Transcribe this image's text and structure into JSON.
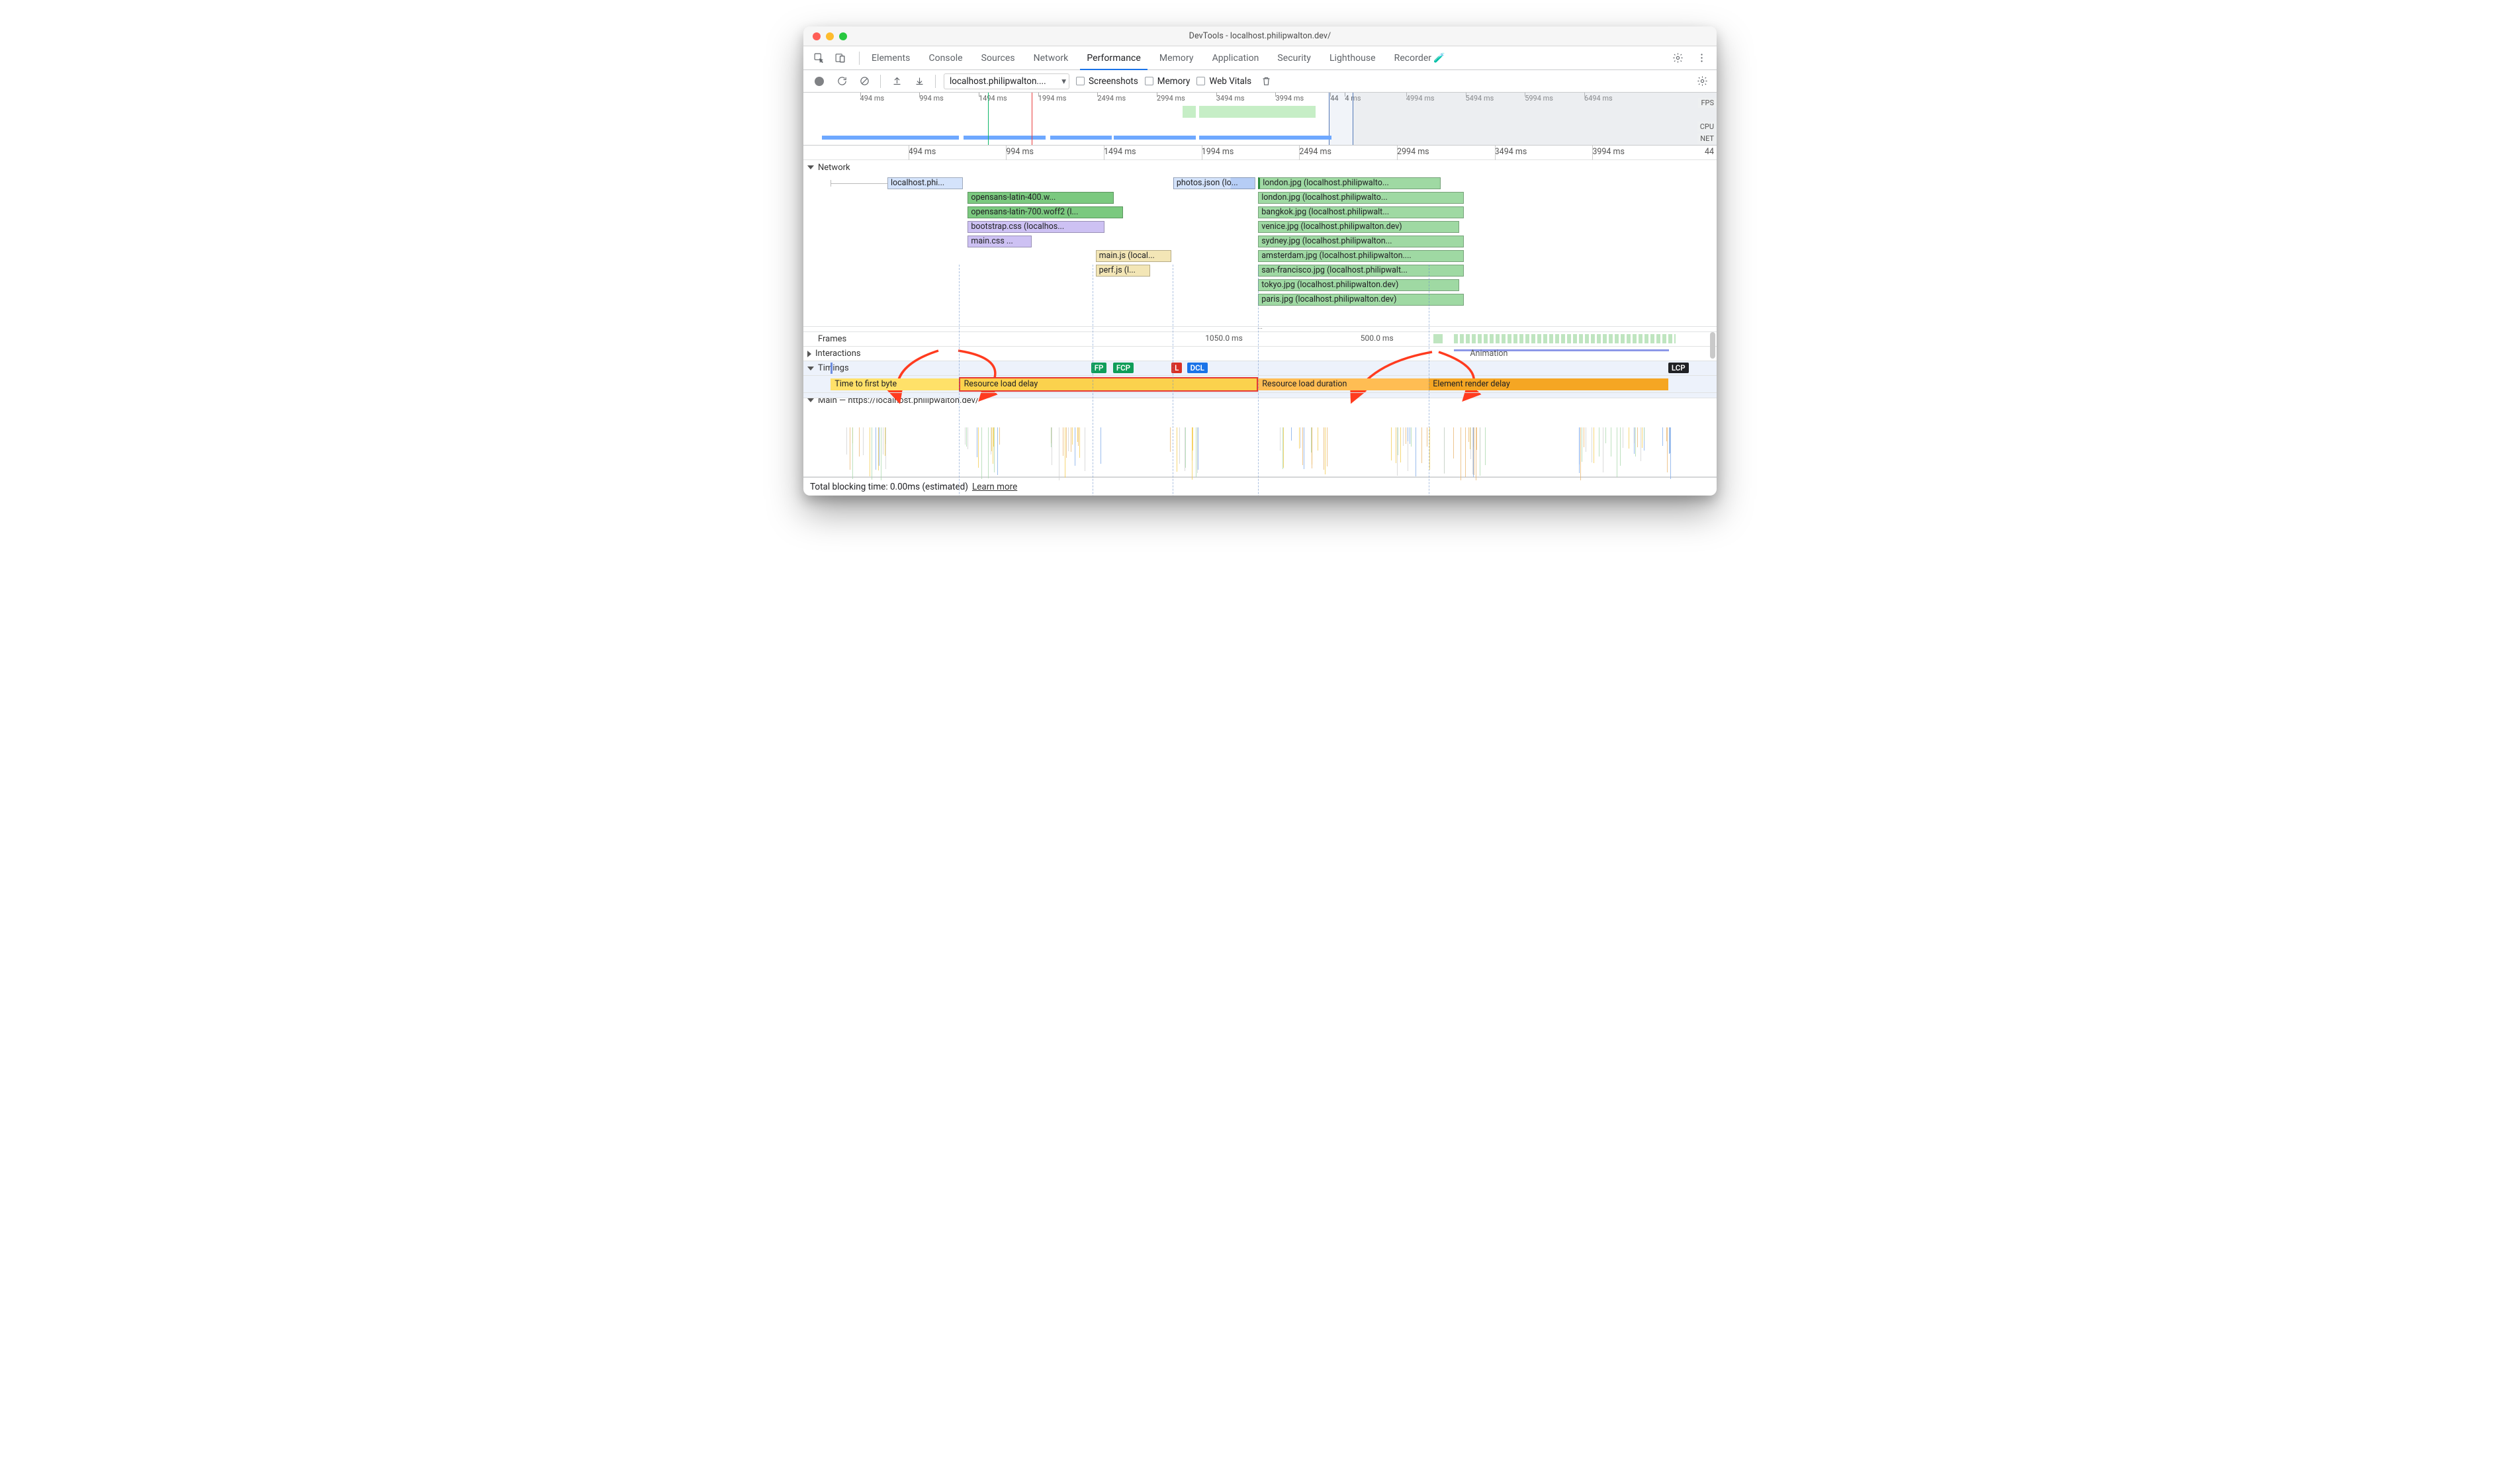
{
  "window": {
    "title": "DevTools - localhost.philipwalton.dev/"
  },
  "tabs": {
    "items": [
      "Elements",
      "Console",
      "Sources",
      "Network",
      "Performance",
      "Memory",
      "Application",
      "Security",
      "Lighthouse",
      "Recorder"
    ],
    "selected": 4,
    "recorder_beaker": "⚗"
  },
  "toolbar": {
    "dropdown": "localhost.philipwalton....",
    "chk_screenshots": "Screenshots",
    "chk_memory": "Memory",
    "chk_web_vitals": "Web Vitals"
  },
  "overview": {
    "ticks": [
      {
        "label": "494 ms",
        "pct": 6.2
      },
      {
        "label": "994 ms",
        "pct": 12.7
      },
      {
        "label": "1494 ms",
        "pct": 19.2
      },
      {
        "label": "1994 ms",
        "pct": 25.7
      },
      {
        "label": "2494 ms",
        "pct": 32.2
      },
      {
        "label": "2994 ms",
        "pct": 38.7
      },
      {
        "label": "3494 ms",
        "pct": 45.2
      },
      {
        "label": "3994 ms",
        "pct": 51.7
      },
      {
        "label": "44",
        "pct": 57.7
      },
      {
        "label": "4 ms",
        "pct": 59.3
      },
      {
        "label": "4994 ms",
        "pct": 66.0
      },
      {
        "label": "5494 ms",
        "pct": 72.5
      },
      {
        "label": "5994 ms",
        "pct": 79.0
      },
      {
        "label": "6494 ms",
        "pct": 85.5
      }
    ],
    "lanes": {
      "fps": "FPS",
      "cpu": "CPU",
      "net": "NET"
    },
    "selection": {
      "left_pct": 57.5,
      "right_pct": 60.2
    },
    "vmarks": [
      {
        "pct": 20.2,
        "color": "#12b76a"
      },
      {
        "pct": 25.0,
        "color": "#e83c3c"
      }
    ],
    "green_blocks": [
      {
        "left_pct": 41.5,
        "w_pct": 1.5
      },
      {
        "left_pct": 43.3,
        "w_pct": 12.8
      }
    ],
    "blue_bars": [
      {
        "left_pct": 2.0,
        "w_pct": 15.0
      },
      {
        "left_pct": 17.5,
        "w_pct": 9.0
      },
      {
        "left_pct": 27.0,
        "w_pct": 6.8
      },
      {
        "left_pct": 34.0,
        "w_pct": 9.0
      },
      {
        "left_pct": 43.3,
        "w_pct": 14.5
      }
    ]
  },
  "ruler2": {
    "ticks": [
      {
        "label": "494 ms",
        "pct": 11.5
      },
      {
        "label": "994 ms",
        "pct": 22.2
      },
      {
        "label": "1494 ms",
        "pct": 32.9
      },
      {
        "label": "1994 ms",
        "pct": 43.6
      },
      {
        "label": "2494 ms",
        "pct": 54.3
      },
      {
        "label": "2994 ms",
        "pct": 65.0
      },
      {
        "label": "3494 ms",
        "pct": 75.7
      },
      {
        "label": "3994 ms",
        "pct": 86.4
      }
    ],
    "overflow": "44"
  },
  "network": {
    "header": "Network",
    "requests": [
      {
        "row": 0,
        "left": 9.2,
        "w": 8.3,
        "color": "#d4e3fb",
        "label": "localhost.phi...",
        "wait_from": 3.0
      },
      {
        "row": 1,
        "left": 18.0,
        "w": 16.0,
        "color": "#7bc97f",
        "label": "opensans-latin-400.w..."
      },
      {
        "row": 2,
        "left": 18.0,
        "w": 17.0,
        "color": "#7bc97f",
        "label": "opensans-latin-700.woff2 (l..."
      },
      {
        "row": 3,
        "left": 18.0,
        "w": 15.0,
        "color": "#cdc1f3",
        "label": "bootstrap.css (localhos..."
      },
      {
        "row": 4,
        "left": 18.0,
        "w": 7.0,
        "color": "#cdc1f3",
        "label": "main.css ..."
      },
      {
        "row": 5,
        "left": 32.0,
        "w": 8.3,
        "color": "#f3e6b6",
        "label": "main.js (local..."
      },
      {
        "row": 6,
        "left": 32.0,
        "w": 6.0,
        "color": "#f3e6b6",
        "label": "perf.js (l..."
      },
      {
        "row": 0,
        "left": 40.5,
        "w": 9.0,
        "color": "#d4e3fb",
        "label": "photos.json (lo...",
        "wait_from": null,
        "two_tone": true
      },
      {
        "row": 0,
        "left": 49.8,
        "w": 20.0,
        "color": "#9fd9a3",
        "label": "london.jpg (localhost.philipwalto...",
        "leftmark": true
      },
      {
        "row": 1,
        "left": 49.8,
        "w": 22.5,
        "color": "#9fd9a3",
        "label": "london.jpg (localhost.philipwalto..."
      },
      {
        "row": 2,
        "left": 49.8,
        "w": 22.5,
        "color": "#9fd9a3",
        "label": "bangkok.jpg (localhost.philipwalt..."
      },
      {
        "row": 3,
        "left": 49.8,
        "w": 22.0,
        "color": "#9fd9a3",
        "label": "venice.jpg (localhost.philipwalton.dev)"
      },
      {
        "row": 4,
        "left": 49.8,
        "w": 22.5,
        "color": "#9fd9a3",
        "label": "sydney.jpg (localhost.philipwalton..."
      },
      {
        "row": 5,
        "left": 49.8,
        "w": 22.5,
        "color": "#9fd9a3",
        "label": "amsterdam.jpg (localhost.philipwalton...."
      },
      {
        "row": 6,
        "left": 49.8,
        "w": 22.5,
        "color": "#9fd9a3",
        "label": "san-francisco.jpg (localhost.philipwalt..."
      },
      {
        "row": 7,
        "left": 49.8,
        "w": 22.0,
        "color": "#9fd9a3",
        "label": "tokyo.jpg (localhost.philipwalton.dev)"
      },
      {
        "row": 8,
        "left": 49.8,
        "w": 22.5,
        "color": "#9fd9a3",
        "label": "paris.jpg (localhost.philipwalton.dev)"
      }
    ]
  },
  "frames": {
    "label": "Frames",
    "f1": "1050.0 ms",
    "f2": "500.0 ms",
    "anim": "Animation"
  },
  "interactions": {
    "label": "Interactions"
  },
  "timings": {
    "label": "Timings",
    "markers": [
      {
        "txt": "FP",
        "left": 31.5,
        "bg": "#0f9d58"
      },
      {
        "txt": "FCP",
        "left": 33.9,
        "bg": "#0f9d58"
      },
      {
        "txt": "L",
        "left": 40.3,
        "bg": "#d93025"
      },
      {
        "txt": "DCL",
        "left": 42.0,
        "bg": "#1a73e8"
      },
      {
        "txt": "LCP",
        "left": 94.7,
        "bg": "#202124"
      }
    ],
    "seg_ttfb": {
      "label": "Time to first byte",
      "left": 3.0,
      "w": 14.0
    },
    "seg_rld": {
      "label": "Resource load delay",
      "left": 17.0,
      "w": 32.8
    },
    "seg_dur": {
      "label": "Resource load duration",
      "left": 49.8,
      "w": 18.7
    },
    "seg_erd": {
      "label": "Element render delay",
      "left": 68.5,
      "w": 26.2
    }
  },
  "main_lane": {
    "label": "Main — https://localhost.philipwalton.dev/"
  },
  "vdash_positions": [
    17.0,
    31.7,
    40.4,
    49.8,
    68.5
  ],
  "status": {
    "text": "Total blocking time: 0.00ms (estimated)",
    "link": "Learn more"
  }
}
